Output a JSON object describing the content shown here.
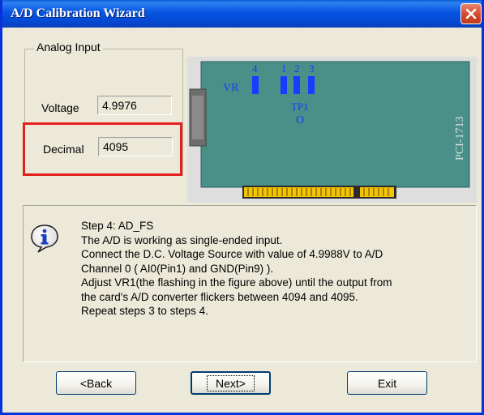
{
  "window": {
    "title": "A/D Calibration Wizard",
    "close_label": "Close"
  },
  "analog_input": {
    "group_label": "Analog Input",
    "voltage_label": "Voltage",
    "voltage_value": "4.9976",
    "decimal_label": "Decimal",
    "decimal_value": "4095"
  },
  "card_figure": {
    "vr_label": "VR",
    "vr_numbers": [
      "4",
      "1",
      "2",
      "3"
    ],
    "tp_label": "TP1",
    "tp_marker": "O",
    "model": "PCI-1713"
  },
  "instructions": {
    "icon": "info-icon",
    "lines": [
      "Step 4: AD_FS",
      "The A/D is working as single-ended input.",
      "Connect the D.C. Voltage Source with value of 4.9988V to A/D",
      "Channel 0 ( AI0(Pin1) and GND(Pin9) ).",
      "Adjust VR1(the flashing in the figure above) until the output from",
      "the card's A/D converter flickers between 4094 and 4095.",
      "Repeat steps 3 to steps 4."
    ]
  },
  "buttons": {
    "back": "<Back",
    "next": "Next>",
    "exit": "Exit"
  },
  "colors": {
    "titlebar": "#0854e3",
    "dialog_bg": "#ece9d8",
    "highlight": "#e2201c",
    "board": "#4a8f88",
    "connector": "#f2c500",
    "vr_blue": "#1a3cff"
  }
}
